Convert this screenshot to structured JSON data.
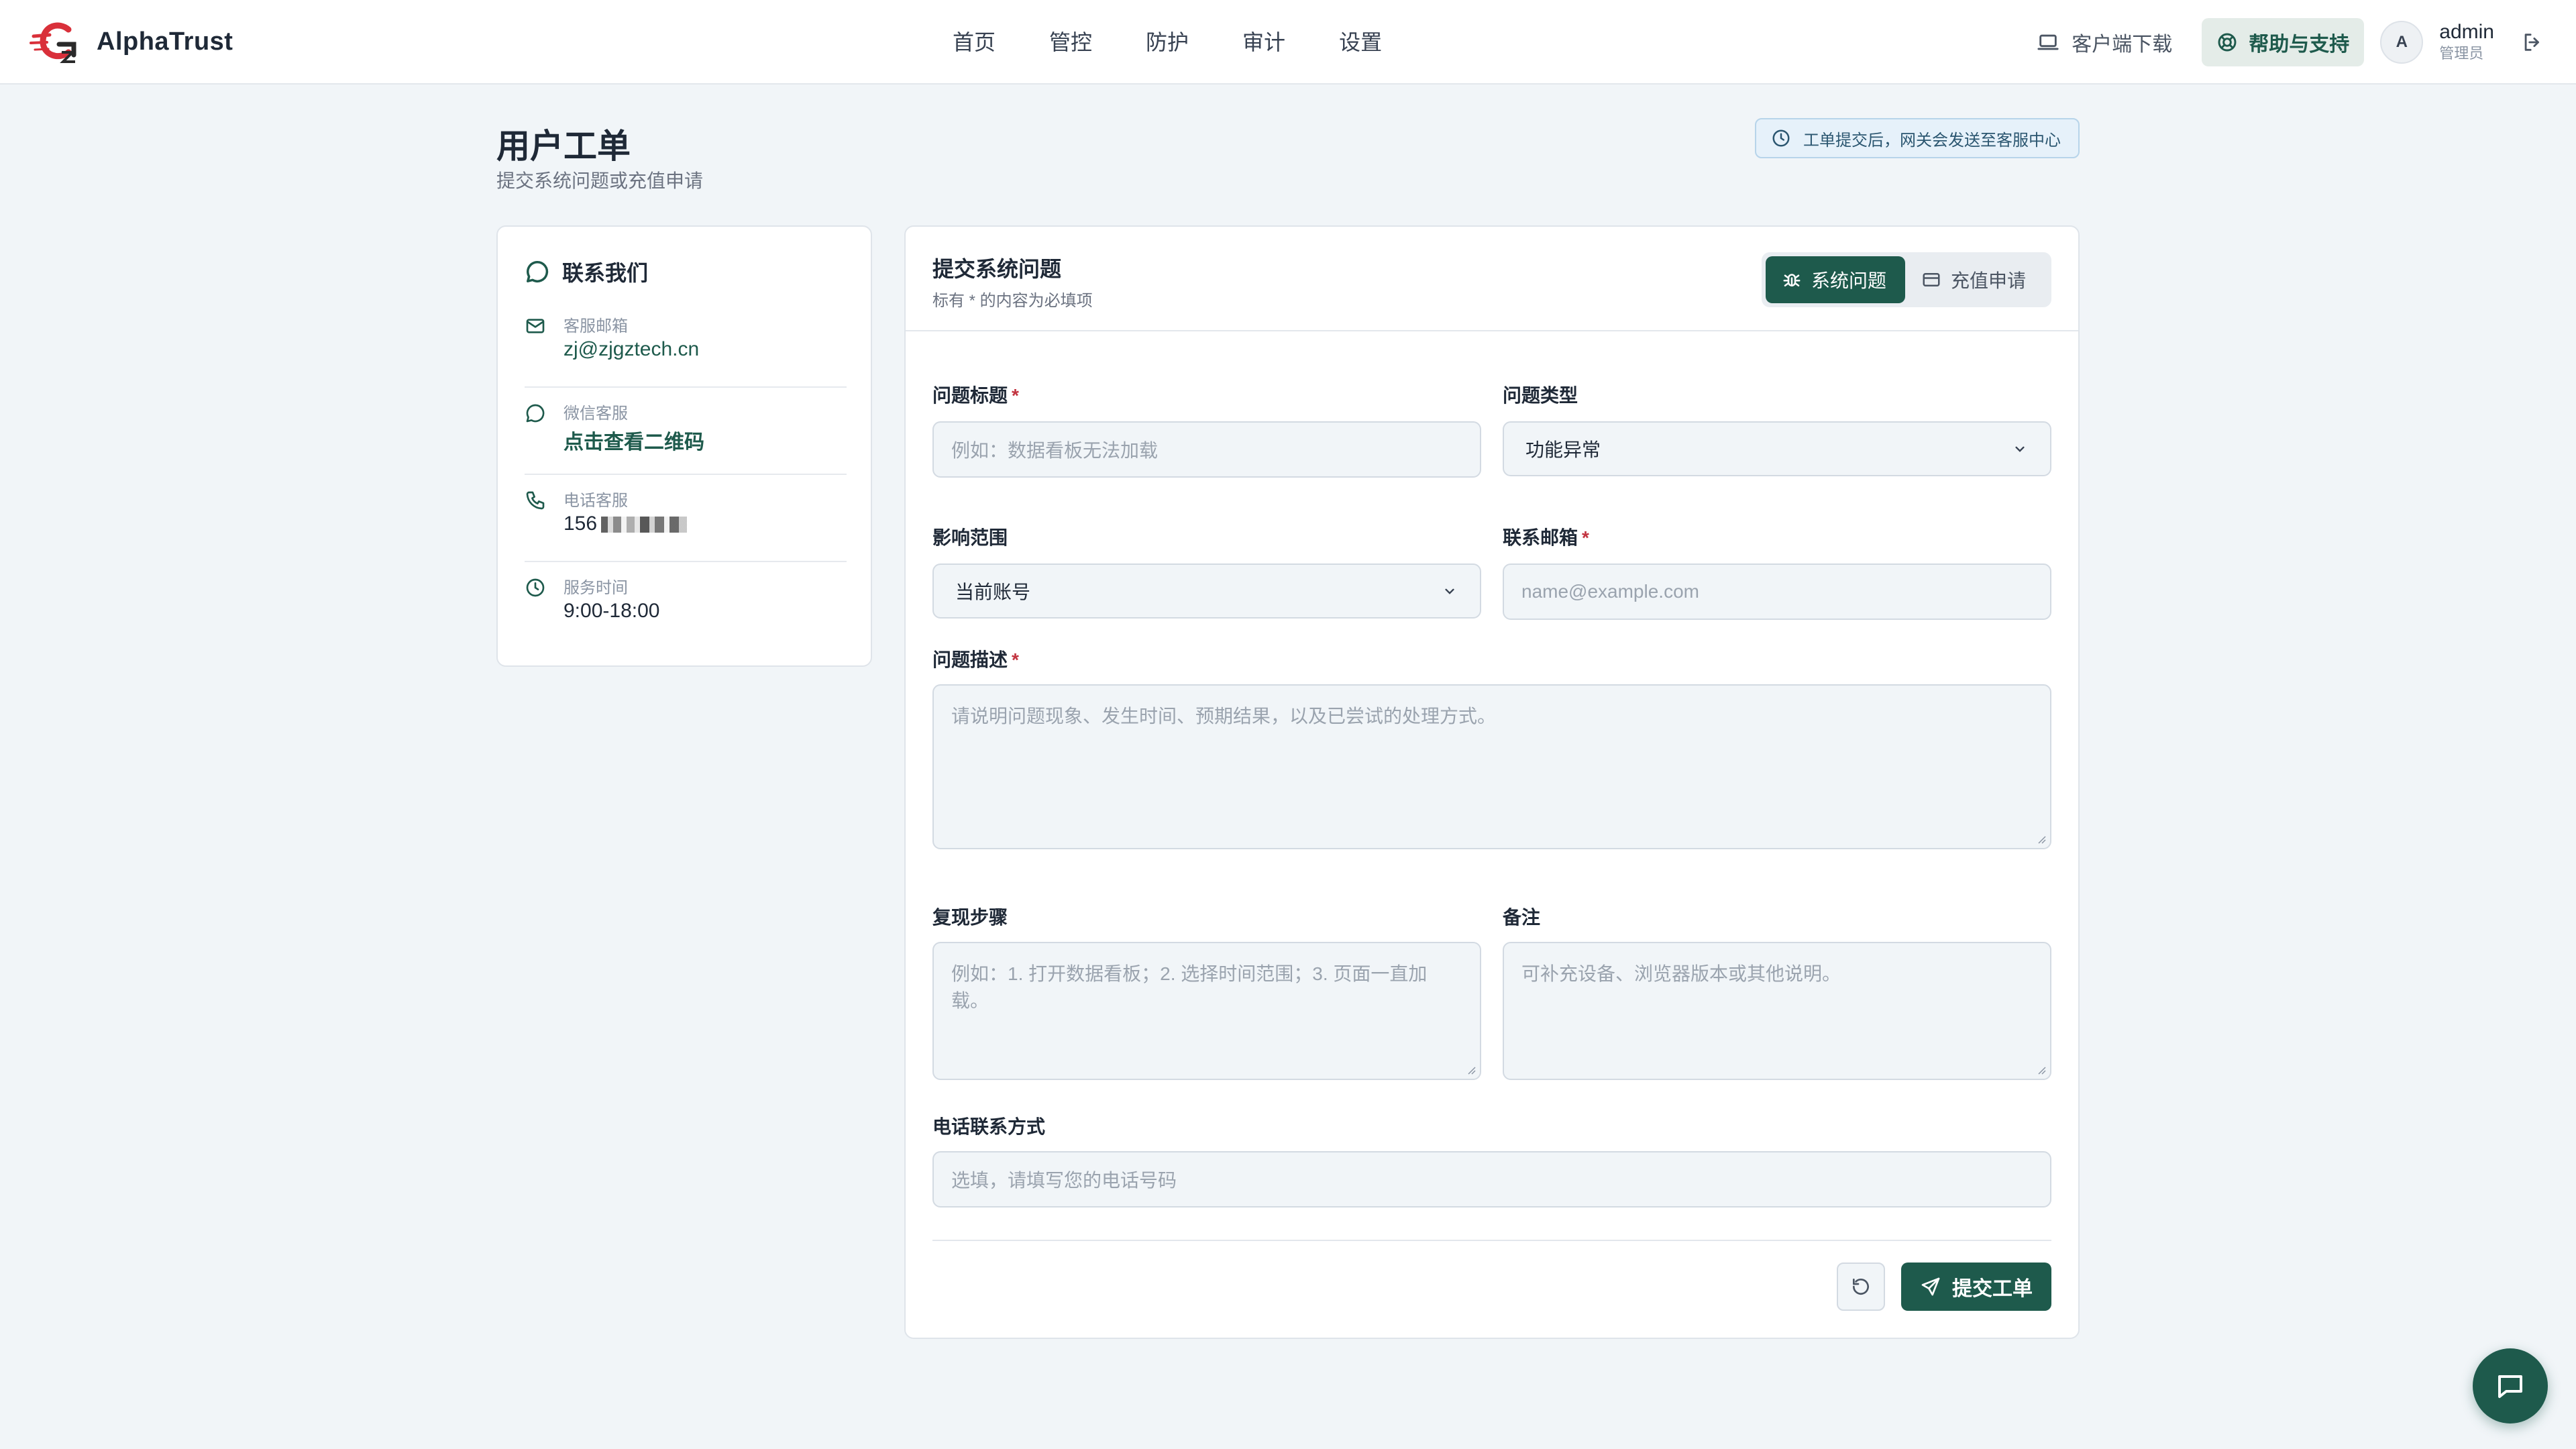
{
  "app": {
    "name": "AlphaTrust"
  },
  "nav": {
    "items": [
      "首页",
      "管控",
      "防护",
      "审计",
      "设置"
    ]
  },
  "header_tools": {
    "download_label": "客户端下载",
    "help_label": "帮助与支持",
    "avatar_initial": "A",
    "user_name": "admin",
    "user_role": "管理员"
  },
  "page": {
    "title": "用户工单",
    "subtitle": "提交系统问题或充值申请",
    "notice": "工单提交后，网关会发送至客服中心"
  },
  "contact": {
    "title": "联系我们",
    "items": [
      {
        "label": "客服邮箱",
        "value": "zj@zjgztech.cn",
        "icon": "mail-icon"
      },
      {
        "label": "微信客服",
        "value": "点击查看二维码",
        "icon": "wechat-icon"
      },
      {
        "label": "电话客服",
        "value": "156",
        "icon": "phone-icon",
        "redacted": true
      },
      {
        "label": "服务时间",
        "value": "9:00-18:00",
        "icon": "clock-icon"
      }
    ]
  },
  "form": {
    "title": "提交系统问题",
    "required_hint": "标有 * 的内容为必填项",
    "tabs": {
      "system": "系统问题",
      "recharge": "充值申请",
      "active": "system"
    },
    "fields": {
      "issue_title": {
        "label": "问题标题",
        "placeholder": "例如：数据看板无法加载",
        "required": true
      },
      "issue_type": {
        "label": "问题类型",
        "value": "功能异常"
      },
      "scope": {
        "label": "影响范围",
        "value": "当前账号"
      },
      "email": {
        "label": "联系邮箱",
        "placeholder": "name@example.com",
        "required": true
      },
      "description": {
        "label": "问题描述",
        "placeholder": "请说明问题现象、发生时间、预期结果，以及已尝试的处理方式。",
        "required": true
      },
      "steps": {
        "label": "复现步骤",
        "placeholder": "例如：1. 打开数据看板；2. 选择时间范围；3. 页面一直加载。"
      },
      "remarks": {
        "label": "备注",
        "placeholder": "可补充设备、浏览器版本或其他说明。"
      },
      "phone": {
        "label": "电话联系方式",
        "placeholder": "选填，请填写您的电话号码"
      }
    },
    "submit_label": "提交工单",
    "required_mark": "*"
  },
  "colors": {
    "accent": "#1e5a4c",
    "required": "#c2333f",
    "notice_bg": "#e6f1fa"
  }
}
